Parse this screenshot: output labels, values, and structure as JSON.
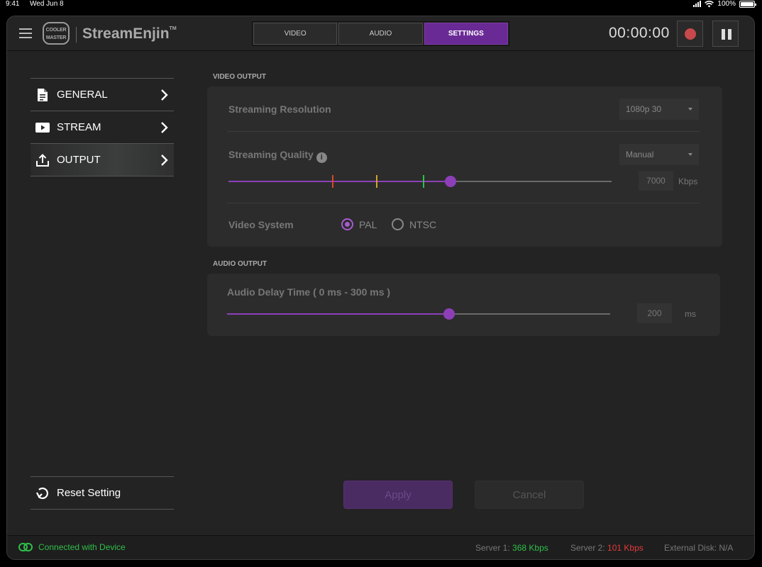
{
  "status_bar": {
    "time": "9:41",
    "date": "Wed Jun 8",
    "battery": "100%"
  },
  "app": {
    "logo_text": [
      "COOLER",
      "MASTER"
    ],
    "brand": "StreamEnjin",
    "brand_tm": "TM",
    "tabs": [
      {
        "label": "VIDEO",
        "active": false
      },
      {
        "label": "AUDIO",
        "active": false
      },
      {
        "label": "SETTINGS",
        "active": true
      }
    ],
    "timer": "00:00:00"
  },
  "sidebar": {
    "items": [
      {
        "label": "GENERAL",
        "icon": "document-icon"
      },
      {
        "label": "STREAM",
        "icon": "play-icon"
      },
      {
        "label": "OUTPUT",
        "icon": "upload-icon",
        "active": true
      }
    ],
    "reset_label": "Reset Setting"
  },
  "video_output": {
    "title": "VIDEO OUTPUT",
    "resolution_label": "Streaming Resolution",
    "resolution_value": "1080p 30",
    "quality_label": "Streaming Quality",
    "quality_mode": "Manual",
    "bitrate_value": "7000",
    "bitrate_unit": "Kbps",
    "bitrate_fraction": 0.58,
    "bitrate_marker_colors": [
      "#d9472b",
      "#d3a12b",
      "#2fbf4a"
    ],
    "video_system_label": "Video System",
    "video_system_options": [
      "PAL",
      "NTSC"
    ],
    "video_system_selected": "PAL"
  },
  "audio_output": {
    "title": "AUDIO OUTPUT",
    "delay_label": "Audio Delay Time ( 0 ms - 300 ms )",
    "delay_value": "200",
    "delay_unit": "ms",
    "delay_fraction": 0.58
  },
  "actions": {
    "apply": "Apply",
    "cancel": "Cancel"
  },
  "footer": {
    "connection": "Connected with Device",
    "server1_label": "Server 1:",
    "server1_value": "368 Kbps",
    "server2_label": "Server 2:",
    "server2_value": "101 Kbps",
    "external_disk": "External Disk: N/A"
  },
  "colors": {
    "accent": "#8d3fb8",
    "record": "#c8494b",
    "ok": "#2fbf4a",
    "alert": "#e23a3a"
  }
}
